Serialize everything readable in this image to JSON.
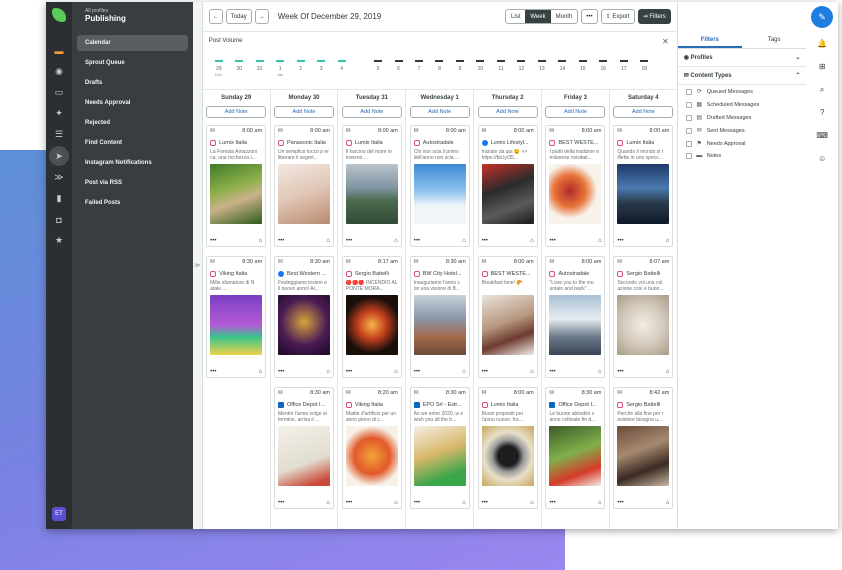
{
  "nav": {
    "subtitle": "All profiles",
    "title": "Publishing",
    "items": [
      {
        "label": "Calendar",
        "active": true
      },
      {
        "label": "Sprout Queue"
      },
      {
        "label": "Drafts"
      },
      {
        "label": "Needs Approval"
      },
      {
        "label": "Rejected"
      },
      {
        "label": "Find Content"
      },
      {
        "label": "Instagram Notifications"
      },
      {
        "label": "Post via RSS"
      },
      {
        "label": "Failed Posts"
      }
    ],
    "avatar": "ET"
  },
  "toolbar": {
    "today": "Today",
    "week_title": "Week Of December 29, 2019",
    "views": [
      "List",
      "Week",
      "Month"
    ],
    "more": "•••",
    "export": "Export",
    "filters": "Filters"
  },
  "post_volume": {
    "label": "Post Volume",
    "days": [
      {
        "num": "29",
        "sub": "Dec",
        "teal": true
      },
      {
        "num": "30",
        "teal": true
      },
      {
        "num": "31",
        "teal": true
      },
      {
        "num": "1",
        "sub": "Jan",
        "teal": true
      },
      {
        "num": "2",
        "teal": true
      },
      {
        "num": "3",
        "teal": true
      },
      {
        "num": "4",
        "teal": true
      },
      {
        "num": "5"
      },
      {
        "num": "6"
      },
      {
        "num": "7"
      },
      {
        "num": "8"
      },
      {
        "num": "9"
      },
      {
        "num": "10"
      },
      {
        "num": "11"
      },
      {
        "num": "12"
      },
      {
        "num": "13"
      },
      {
        "num": "14"
      },
      {
        "num": "15"
      },
      {
        "num": "16"
      },
      {
        "num": "17"
      },
      {
        "num": "18"
      }
    ]
  },
  "calendar": {
    "add_note": "Add Note",
    "days": [
      {
        "name": "Sunday 29",
        "cards": [
          {
            "time": "8:00 am",
            "net": "ig",
            "acct": "Lumix Italia",
            "text": "La Foresta Amazzoni ca: una ricchezza i...",
            "img": "linear-gradient(160deg,#3f7a2a,#8fb04a 40%,#c9b28a 60%,#2e5a1e)"
          },
          {
            "time": "8:30 am",
            "net": "ig",
            "acct": "Viking Italia",
            "text": "Mille sfumature di N atale....",
            "img": "linear-gradient(180deg,#7b3fc4,#b45ad6 50%,#38c48a 70%,#f0d24a)"
          }
        ]
      },
      {
        "name": "Monday 30",
        "cards": [
          {
            "time": "8:00 am",
            "net": "ig",
            "acct": "Panasonic Italia",
            "text": "Un semplice tocco p er liberare il segret...",
            "img": "linear-gradient(160deg,#f3e9e3,#e0c6b5 50%,#b98a70)"
          },
          {
            "time": "8:30 am",
            "net": "fb",
            "acct": "Best Western ...",
            "text": "Festeggiamo insiem e il nuovo anno! Al...",
            "img": "radial-gradient(circle at 50% 45%,#d7a43a,#4a1c55 55%,#1a0a22)"
          },
          {
            "time": "8:30 am",
            "net": "li",
            "acct": "Office Depot I...",
            "text": "Mentre l'anno volge al termine, arriva il ...",
            "img": "linear-gradient(160deg,#f4f1ea,#e2ddd0 60%,#c94a3a 90%)"
          }
        ]
      },
      {
        "name": "Tuesday 31",
        "cards": [
          {
            "time": "8:00 am",
            "net": "ig",
            "acct": "Lumix Italia",
            "text": "Il fascino del mare in inverno....",
            "img": "linear-gradient(180deg,#b8c4cc,#8094a2 40%,#4d6b4e 60%,#2f4a36)"
          },
          {
            "time": "8:17 am",
            "net": "ig",
            "acct": "Sergio Battelli",
            "text": "🔴🔴🔴 INCENDIO AL PONTE MORA...",
            "img": "radial-gradient(circle at 50% 50%,#f7b54a,#c2401c 35%,#1b0f0c 70%)"
          },
          {
            "time": "8:20 am",
            "net": "ig",
            "acct": "Viking Italia",
            "text": "Matite d'artificio per un anno pieno di c...",
            "img": "radial-gradient(circle,#f3a13a,#e05a2a 45%,#f7f1e7 75%)"
          }
        ]
      },
      {
        "name": "Wednesday 1",
        "cards": [
          {
            "time": "8:00 am",
            "net": "ig",
            "acct": "Autostradale",
            "text": "Chi non scia il primo dell'anno non scia ...",
            "img": "linear-gradient(180deg,#3e8ad6,#8fc3ee 45%,#f1f5f8 70%)"
          },
          {
            "time": "8:30 am",
            "net": "ig",
            "acct": "BW City Hotel...",
            "text": "Inauguriamo l'anno c on una visione di B...",
            "img": "linear-gradient(180deg,#c9d3de,#8a95a6 40%,#a36a4c 70%,#6b4b3a)"
          },
          {
            "time": "8:30 am",
            "net": "li",
            "acct": "EPO Srl - Estr...",
            "text": "As we enter 2020, w e wish you all the b...",
            "img": "linear-gradient(160deg,#f5efe4,#d8b76a 45%,#3aa64a 80%)"
          }
        ]
      },
      {
        "name": "Thursday 2",
        "cards": [
          {
            "time": "8:00 am",
            "net": "fb",
            "acct": "Lumix Lifestyl...",
            "text": "Iniziate da qui 😉 >> https://bit.ly/35...",
            "img": "linear-gradient(160deg,#c8302a,#2b2b2b 40%,#5b5b5b 70%,#1a1a1a)"
          },
          {
            "time": "8:00 am",
            "net": "ig",
            "acct": "BEST WESTE...",
            "text": "Breakfast time! 🥐",
            "img": "linear-gradient(160deg,#e9e3dc,#b89880 45%,#6d3a30 70%,#f1ede8)"
          },
          {
            "time": "8:00 am",
            "net": "ig",
            "acct": "Lumix Italia",
            "text": "Buoni propositi per l'anno nuovo: foc...",
            "img": "radial-gradient(circle,#1d1d1d 25%,#9a9a9a 40%,#e7dfc8 60%,#c7a65a)"
          }
        ]
      },
      {
        "name": "Friday 3",
        "cards": [
          {
            "time": "8:00 am",
            "net": "ig",
            "acct": "BEST WESTE...",
            "text": "I piatti della tradizion e milanese rivisitati...",
            "img": "radial-gradient(circle at 40% 45%,#b02a2a,#e8743a 35%,#f7f2ea 60%)"
          },
          {
            "time": "8:00 am",
            "net": "ig",
            "acct": "Autostradale",
            "text": "\"Love you to the mo untain and back\" ...",
            "img": "linear-gradient(180deg,#a9c0d6,#e8ecf0 40%,#6a7a8a 70%,#3a4452)"
          },
          {
            "time": "8:30 am",
            "net": "li",
            "acct": "Office Depot I...",
            "text": "Le buone abitudini v anno coltivate fin d...",
            "img": "linear-gradient(160deg,#3d5a2a,#7fb04a 45%,#d63a2a 75%,#f1ede6)"
          }
        ]
      },
      {
        "name": "Saturday 4",
        "cards": [
          {
            "time": "8:00 am",
            "net": "ig",
            "acct": "Lumix Italia",
            "text": "Quando il mondo si r iflette in uno specc...",
            "img": "linear-gradient(180deg,#1e3a6a,#4a7ab0 40%,#2a3a4a 65%,#0f1a2a)"
          },
          {
            "time": "8:07 am",
            "net": "ig",
            "acct": "Sergio Battelli",
            "text": "Secondo voi una col azione così è buon...",
            "img": "radial-gradient(circle,#f1ece4,#d5cbbd 50%,#a89a88)"
          },
          {
            "time": "8:42 am",
            "net": "ig",
            "acct": "Sergio Battelli",
            "text": "Perché alla fine per r esistere bisogna u...",
            "img": "linear-gradient(160deg,#6a4a3a,#a58a70 40%,#3a2a22 70%,#c9b8a2)"
          }
        ]
      }
    ]
  },
  "filters": {
    "tabs": [
      "Filters",
      "Tags"
    ],
    "profiles_label": "Profiles",
    "content_types_label": "Content Types",
    "options": [
      "Queued Messages",
      "Scheduled Messages",
      "Drafted Messages",
      "Sent Messages",
      "Needs Approval",
      "Notes"
    ]
  },
  "colors": {
    "accent": "#1e7de0",
    "teal": "#36c4b0",
    "nav_bg": "#383d40"
  }
}
